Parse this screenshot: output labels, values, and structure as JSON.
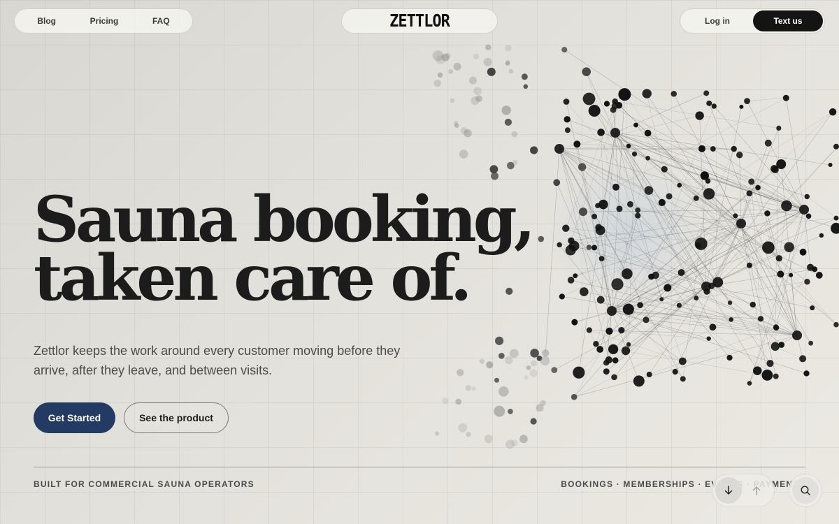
{
  "nav": {
    "links": [
      {
        "label": "Blog"
      },
      {
        "label": "Pricing"
      },
      {
        "label": "FAQ"
      }
    ],
    "brand": "ZETTLOR",
    "login": "Log in",
    "cta": "Text us"
  },
  "hero": {
    "headline_line1": "Sauna booking,",
    "headline_line2": "taken care of.",
    "subtitle": "Zettlor keeps the work around every customer moving before they arrive, after they leave, and between visits.",
    "primary_button": "Get Started",
    "secondary_button": "See the product"
  },
  "footer": {
    "left_caption": "BUILT FOR COMMERCIAL SAUNA OPERATORS",
    "right_caption": "BOOKINGS · MEMBERSHIPS · EVENTS · PAYMENTS"
  },
  "controls": {
    "scroll_down_icon": "arrow-down-icon",
    "scroll_up_icon": "arrow-up-icon",
    "search_icon": "search-icon"
  },
  "colors": {
    "primary": "#233a63",
    "dark": "#141414",
    "text": "#1c1c1c",
    "muted": "#4b4b4b"
  }
}
